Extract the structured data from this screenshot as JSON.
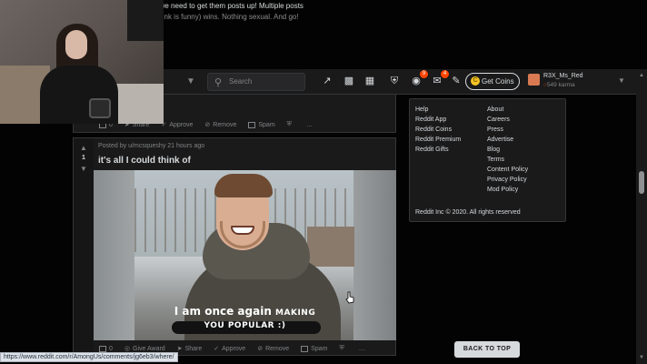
{
  "header": {
    "search_placeholder": "Search",
    "get_coins_label": "Get Coins",
    "coin_symbol": "C",
    "username": "R3X_Ms_Red",
    "karma": "549 karma",
    "badges": [
      "9",
      "4"
    ]
  },
  "post1": {
    "text_line1": "o use it for good. Plus we need to get them posts up! Multiple posts",
    "text_line2": "p voted (or one that I think is funny) wins. Nothing sexual. And go!",
    "actions": {
      "comments": "0",
      "share": "Share",
      "approve": "Approve",
      "remove": "Remove",
      "spam": "Spam",
      "more": "…"
    }
  },
  "post2": {
    "vote_count": "1",
    "meta": "Posted by u/mcsqueshy 21 hours ago",
    "title": "it's all I could think of",
    "caption_line1_big": "I am once again ",
    "caption_line1_small": "MAKING",
    "caption_line2": "YOU POPULAR :)",
    "actions": {
      "comments": "0",
      "give_award": "Give Award",
      "share": "Share",
      "approve": "Approve",
      "remove": "Remove",
      "spam": "Spam",
      "more": "…"
    }
  },
  "sidebar": {
    "col1": [
      "Help",
      "Reddit App",
      "Reddit Coins",
      "Reddit Premium",
      "Reddit Gifts"
    ],
    "col2": [
      "About",
      "Careers",
      "Press",
      "Advertise",
      "Blog",
      "Terms",
      "Content Policy",
      "Privacy Policy",
      "Mod Policy"
    ],
    "copyright": "Reddit Inc © 2020. All rights reserved"
  },
  "back_to_top_label": "BACK TO TOP",
  "status_url": "https://www.reddit.com/r/AmongUs/comments/jg6eb3/where/",
  "colors": {
    "background": "#030303",
    "card": "#1a1a1b",
    "border": "#343536",
    "accent": "#ff4500",
    "coin": "#f6c324"
  }
}
